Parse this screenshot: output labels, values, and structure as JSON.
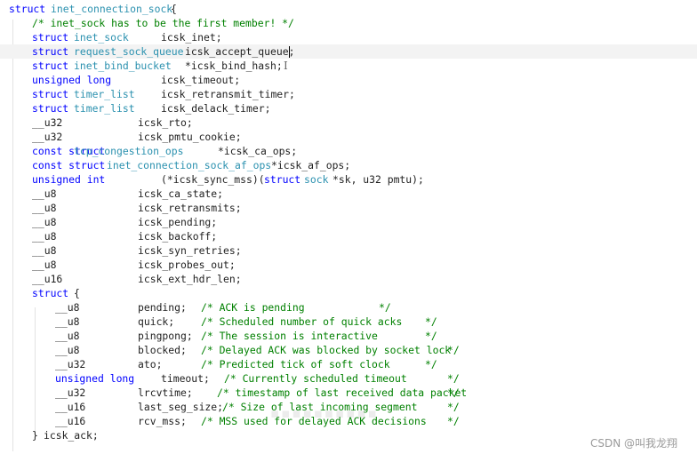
{
  "editor": {
    "lines": [
      {
        "segments": [
          {
            "text": "struct",
            "kind": "kw"
          },
          {
            "text": "inet_connection_sock",
            "kind": "ty"
          },
          {
            "text": "{",
            "kind": "id"
          }
        ]
      },
      {
        "segments": [
          {
            "text": "/* inet_sock has to be the first member! */",
            "kind": "cm"
          }
        ]
      },
      {
        "segments": [
          {
            "text": "struct",
            "kind": "kw"
          },
          {
            "text": "inet_sock",
            "kind": "ty"
          },
          {
            "text": "icsk_inet;",
            "kind": "id"
          }
        ]
      },
      {
        "segments": [
          {
            "text": "struct",
            "kind": "kw"
          },
          {
            "text": "request_sock_queue",
            "kind": "ty"
          },
          {
            "text": "icsk_accept_queue;",
            "kind": "id"
          }
        ]
      },
      {
        "segments": [
          {
            "text": "struct",
            "kind": "kw"
          },
          {
            "text": "inet_bind_bucket",
            "kind": "ty"
          },
          {
            "text": "*icsk_bind_hash;",
            "kind": "id"
          }
        ]
      },
      {
        "segments": [
          {
            "text": "unsigned long",
            "kind": "kw"
          },
          {
            "text": "icsk_timeout;",
            "kind": "id"
          }
        ]
      },
      {
        "segments": [
          {
            "text": "struct",
            "kind": "kw"
          },
          {
            "text": "timer_list",
            "kind": "ty"
          },
          {
            "text": "icsk_retransmit_timer;",
            "kind": "id"
          }
        ]
      },
      {
        "segments": [
          {
            "text": "struct",
            "kind": "kw"
          },
          {
            "text": "timer_list",
            "kind": "ty"
          },
          {
            "text": "icsk_delack_timer;",
            "kind": "id"
          }
        ]
      },
      {
        "segments": [
          {
            "text": "__u32",
            "kind": "id"
          },
          {
            "text": "icsk_rto;",
            "kind": "id"
          }
        ]
      },
      {
        "segments": [
          {
            "text": "__u32",
            "kind": "id"
          },
          {
            "text": "icsk_pmtu_cookie;",
            "kind": "id"
          }
        ]
      },
      {
        "segments": [
          {
            "text": "const struct",
            "kind": "kw"
          },
          {
            "text": "tcp_congestion_ops",
            "kind": "ty"
          },
          {
            "text": "*icsk_ca_ops;",
            "kind": "id"
          }
        ]
      },
      {
        "segments": [
          {
            "text": "const struct",
            "kind": "kw"
          },
          {
            "text": "inet_connection_sock_af_ops",
            "kind": "ty"
          },
          {
            "text": "*icsk_af_ops;",
            "kind": "id"
          }
        ]
      },
      {
        "segments": [
          {
            "text": "unsigned int",
            "kind": "kw"
          },
          {
            "text": "(*icsk_sync_mss)(",
            "kind": "id"
          },
          {
            "text": "struct",
            "kind": "kw"
          },
          {
            "text": "sock",
            "kind": "ty"
          },
          {
            "text": "*sk, u32 pmtu);",
            "kind": "id"
          }
        ]
      },
      {
        "segments": [
          {
            "text": "__u8",
            "kind": "id"
          },
          {
            "text": "icsk_ca_state;",
            "kind": "id"
          }
        ]
      },
      {
        "segments": [
          {
            "text": "__u8",
            "kind": "id"
          },
          {
            "text": "icsk_retransmits;",
            "kind": "id"
          }
        ]
      },
      {
        "segments": [
          {
            "text": "__u8",
            "kind": "id"
          },
          {
            "text": "icsk_pending;",
            "kind": "id"
          }
        ]
      },
      {
        "segments": [
          {
            "text": "__u8",
            "kind": "id"
          },
          {
            "text": "icsk_backoff;",
            "kind": "id"
          }
        ]
      },
      {
        "segments": [
          {
            "text": "__u8",
            "kind": "id"
          },
          {
            "text": "icsk_syn_retries;",
            "kind": "id"
          }
        ]
      },
      {
        "segments": [
          {
            "text": "__u8",
            "kind": "id"
          },
          {
            "text": "icsk_probes_out;",
            "kind": "id"
          }
        ]
      },
      {
        "segments": [
          {
            "text": "__u16",
            "kind": "id"
          },
          {
            "text": "icsk_ext_hdr_len;",
            "kind": "id"
          }
        ]
      },
      {
        "segments": [
          {
            "text": "struct",
            "kind": "kw"
          },
          {
            "text": "{",
            "kind": "id"
          }
        ]
      },
      {
        "segments": [
          {
            "text": "__u8",
            "kind": "id"
          },
          {
            "text": "pending;",
            "kind": "id"
          },
          {
            "text": "/* ACK is pending",
            "kind": "cm"
          },
          {
            "text": "*/",
            "kind": "cm"
          }
        ]
      },
      {
        "segments": [
          {
            "text": "__u8",
            "kind": "id"
          },
          {
            "text": "quick;",
            "kind": "id"
          },
          {
            "text": "/* Scheduled number of quick acks",
            "kind": "cm"
          },
          {
            "text": "*/",
            "kind": "cm"
          }
        ]
      },
      {
        "segments": [
          {
            "text": "__u8",
            "kind": "id"
          },
          {
            "text": "pingpong;",
            "kind": "id"
          },
          {
            "text": "/* The session is interactive",
            "kind": "cm"
          },
          {
            "text": "*/",
            "kind": "cm"
          }
        ]
      },
      {
        "segments": [
          {
            "text": "__u8",
            "kind": "id"
          },
          {
            "text": "blocked;",
            "kind": "id"
          },
          {
            "text": "/* Delayed ACK was blocked by socket lock",
            "kind": "cm"
          },
          {
            "text": "*/",
            "kind": "cm"
          }
        ]
      },
      {
        "segments": [
          {
            "text": "__u32",
            "kind": "id"
          },
          {
            "text": "ato;",
            "kind": "id"
          },
          {
            "text": "/* Predicted tick of soft clock",
            "kind": "cm"
          },
          {
            "text": "*/",
            "kind": "cm"
          }
        ]
      },
      {
        "segments": [
          {
            "text": "unsigned long",
            "kind": "kw"
          },
          {
            "text": "timeout;",
            "kind": "id"
          },
          {
            "text": "/* Currently scheduled timeout",
            "kind": "cm"
          },
          {
            "text": "*/",
            "kind": "cm"
          }
        ]
      },
      {
        "segments": [
          {
            "text": "__u32",
            "kind": "id"
          },
          {
            "text": "lrcvtime;",
            "kind": "id"
          },
          {
            "text": "/* timestamp of last received data packet",
            "kind": "cm"
          },
          {
            "text": "*/",
            "kind": "cm"
          }
        ]
      },
      {
        "segments": [
          {
            "text": "__u16",
            "kind": "id"
          },
          {
            "text": "last_seg_size;",
            "kind": "id"
          },
          {
            "text": "/* Size of last incoming segment",
            "kind": "cm"
          },
          {
            "text": "*/",
            "kind": "cm"
          }
        ]
      },
      {
        "segments": [
          {
            "text": "__u16",
            "kind": "id"
          },
          {
            "text": "rcv_mss;",
            "kind": "id"
          },
          {
            "text": "/* MSS used for delayed ACK decisions",
            "kind": "cm"
          },
          {
            "text": "*/",
            "kind": "cm"
          }
        ]
      },
      {
        "segments": [
          {
            "text": "}",
            "kind": "id"
          },
          {
            "text": "icsk_ack;",
            "kind": "id"
          }
        ]
      }
    ]
  },
  "watermark": {
    "text": "CSDN @叫我龙翔"
  },
  "colors": {
    "keyword": "#0000ff",
    "type": "#2b91af",
    "comment": "#008000",
    "text": "#1f1f1f",
    "current_line": "#f3f3f3"
  }
}
